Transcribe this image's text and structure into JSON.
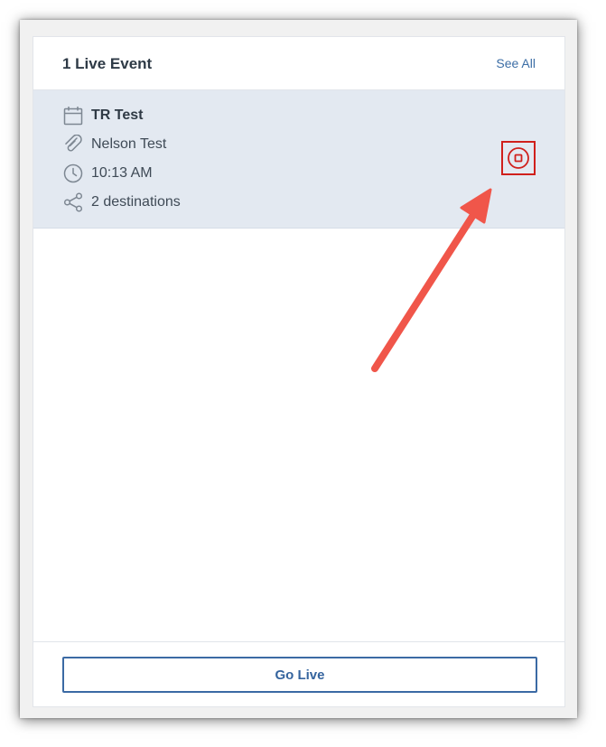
{
  "header": {
    "title": "1 Live Event",
    "see_all_label": "See All"
  },
  "event": {
    "name": "TR Test",
    "presenter": "Nelson Test",
    "time": "10:13 AM",
    "destinations": "2 destinations",
    "icons": [
      "calendar-icon",
      "paperclip-icon",
      "clock-icon",
      "share-icon",
      "stop-icon"
    ]
  },
  "footer": {
    "go_live_label": "Go Live"
  },
  "colors": {
    "accent": "#3b6aa4",
    "row_highlight": "#e3e9f1",
    "stop_red": "#d0201c",
    "annotation_arrow": "#f0564a"
  }
}
